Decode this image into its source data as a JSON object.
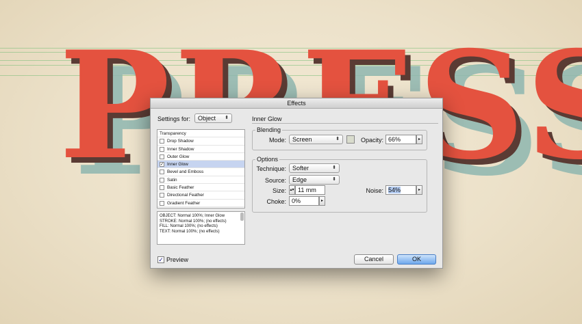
{
  "background": {
    "word": "PRESS",
    "colors": {
      "paper": "#ece1c9",
      "main": "#e4523f",
      "shadow_dark": "#5a3b34",
      "shadow_teal": "#8fb7b0",
      "guide": "#78be78"
    }
  },
  "dialog": {
    "title": "Effects",
    "settings_for_label": "Settings for:",
    "settings_for_value": "Object",
    "section_title": "Inner Glow",
    "effects_list": {
      "header": "Transparency",
      "items": [
        {
          "label": "Drop Shadow",
          "checked": false,
          "mark": ""
        },
        {
          "label": "Inner Shadow",
          "checked": false,
          "mark": ""
        },
        {
          "label": "Outer Glow",
          "checked": false,
          "mark": ""
        },
        {
          "label": "Inner Glow",
          "checked": true,
          "mark": "✓"
        },
        {
          "label": "Bevel and Emboss",
          "checked": false,
          "mark": ""
        },
        {
          "label": "Satin",
          "checked": false,
          "mark": ""
        },
        {
          "label": "Basic Feather",
          "checked": false,
          "mark": ""
        },
        {
          "label": "Directional Feather",
          "checked": false,
          "mark": ""
        },
        {
          "label": "Gradient Feather",
          "checked": false,
          "mark": ""
        }
      ]
    },
    "summary": [
      "OBJECT: Normal 100%; Inner Glow",
      "STROKE: Normal 100%; (no effects)",
      "FILL: Normal 100%; (no effects)",
      "TEXT: Normal 100%; (no effects)"
    ],
    "blending": {
      "title": "Blending",
      "mode_label": "Mode:",
      "mode_value": "Screen",
      "glow_color": "#d9dccd",
      "opacity_label": "Opacity:",
      "opacity_value": "66%"
    },
    "options": {
      "title": "Options",
      "technique_label": "Technique:",
      "technique_value": "Softer",
      "source_label": "Source:",
      "source_value": "Edge",
      "size_label": "Size:",
      "size_value": "11 mm",
      "noise_label": "Noise:",
      "noise_value": "54%",
      "choke_label": "Choke:",
      "choke_value": "0%"
    },
    "preview_label": "Preview",
    "preview_checked": true,
    "cancel_label": "Cancel",
    "ok_label": "OK",
    "icons": {
      "popup_arrows": "⬍",
      "field_arrow": "▸",
      "stepper": "▴▾"
    }
  }
}
